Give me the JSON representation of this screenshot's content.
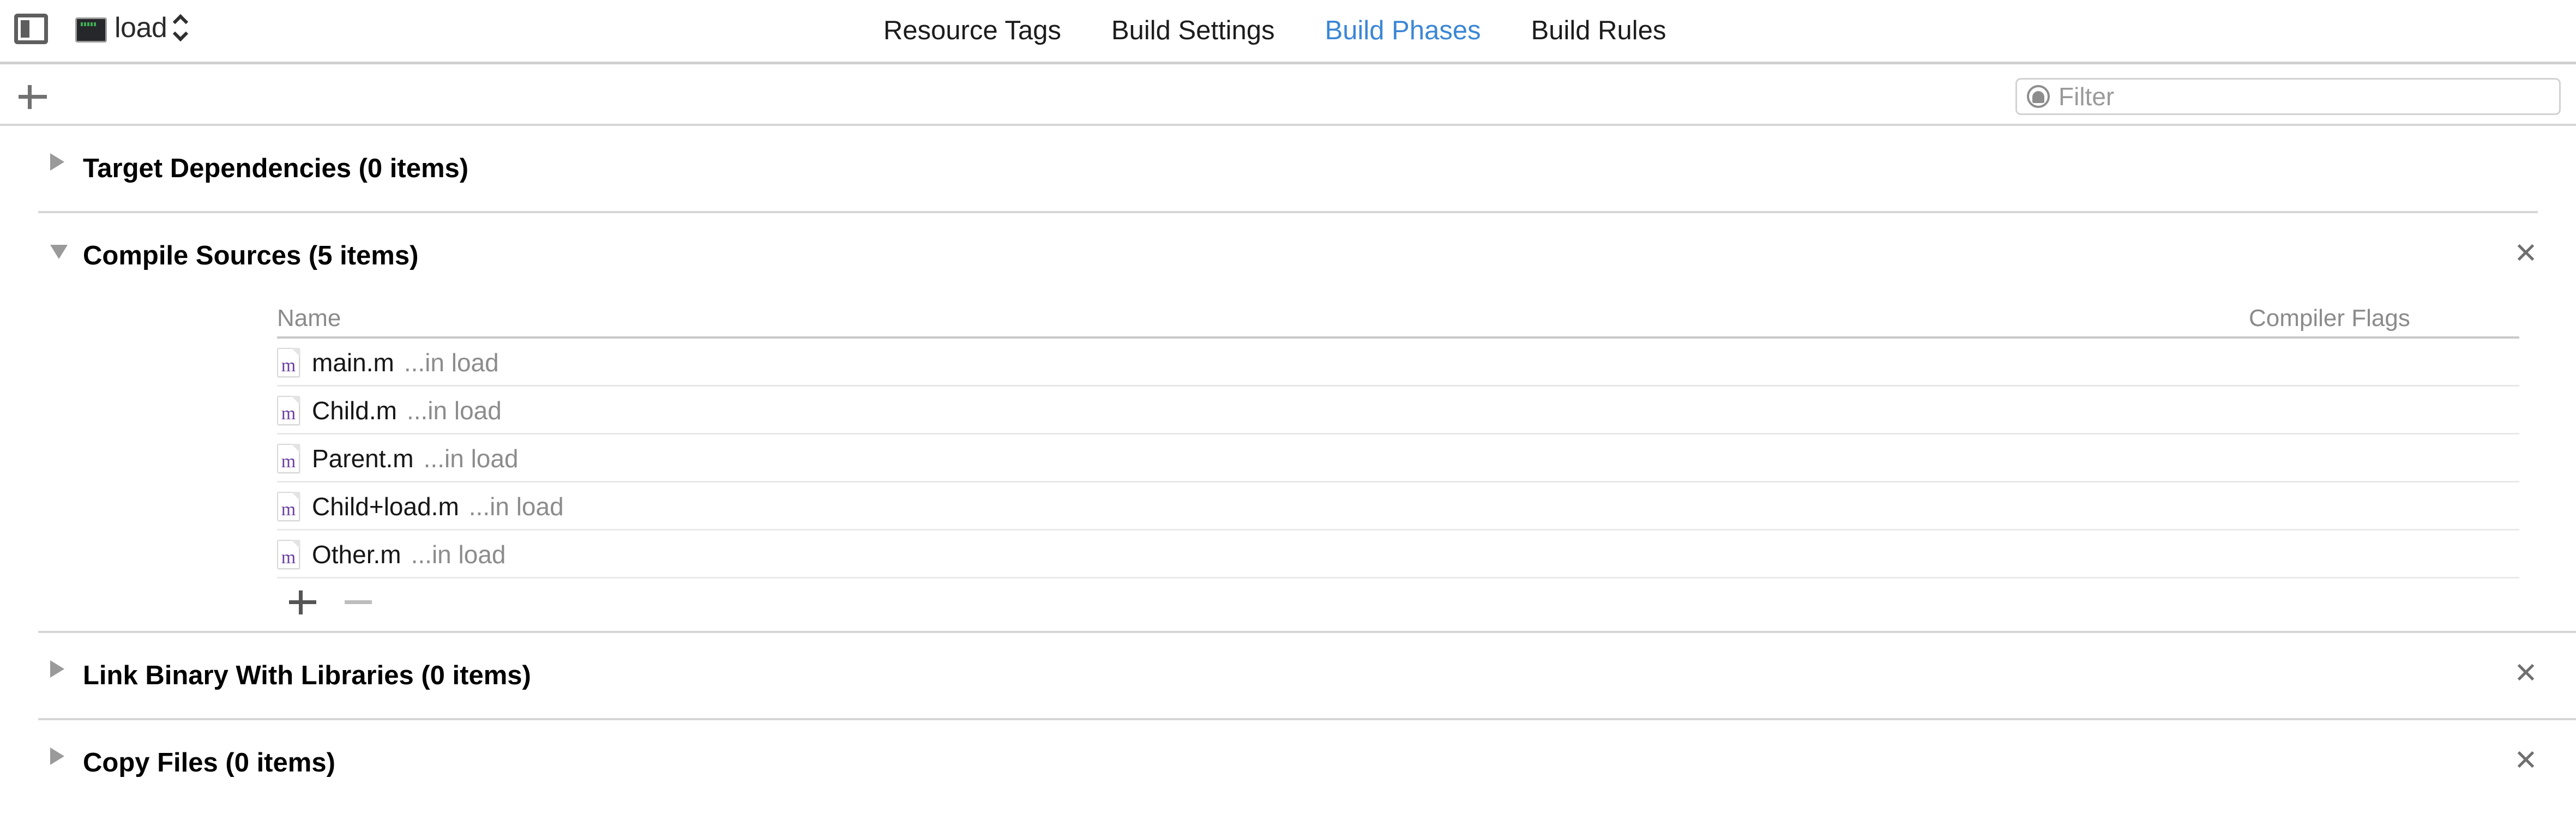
{
  "titlebar": {
    "sidebar_toggle_icon": "sidebar-toggle-icon",
    "target_icon": "command-line-tool-icon",
    "scheme_name": "load",
    "stepper_icon": "up-down-chevron-icon",
    "tabs": [
      {
        "label": "Resource Tags",
        "active": false
      },
      {
        "label": "Build Settings",
        "active": false
      },
      {
        "label": "Build Phases",
        "active": true
      },
      {
        "label": "Build Rules",
        "active": false
      }
    ],
    "active_tab_color": "#3b87d6"
  },
  "subbar": {
    "add_phase_icon": "plus-icon",
    "filter": {
      "icon": "filter-circle-icon",
      "placeholder": "Filter",
      "value": ""
    }
  },
  "phases": [
    {
      "title": "Target Dependencies (0 items)",
      "expanded": false,
      "disclosure_icon": "chevron-right-icon",
      "has_close": false,
      "close_icon": "close-icon"
    },
    {
      "title": "Compile Sources (5 items)",
      "expanded": true,
      "disclosure_icon": "chevron-down-icon",
      "has_close": true,
      "close_icon": "close-icon",
      "table": {
        "columns": [
          "Name",
          "Compiler Flags"
        ],
        "rows": [
          {
            "icon": "objc-file-icon",
            "icon_glyph": "m",
            "name": "main.m",
            "location": "...in load",
            "flags": ""
          },
          {
            "icon": "objc-file-icon",
            "icon_glyph": "m",
            "name": "Child.m",
            "location": "...in load",
            "flags": ""
          },
          {
            "icon": "objc-file-icon",
            "icon_glyph": "m",
            "name": "Parent.m",
            "location": "...in load",
            "flags": ""
          },
          {
            "icon": "objc-file-icon",
            "icon_glyph": "m",
            "name": "Child+load.m",
            "location": "...in load",
            "flags": ""
          },
          {
            "icon": "objc-file-icon",
            "icon_glyph": "m",
            "name": "Other.m",
            "location": "...in load",
            "flags": ""
          }
        ],
        "add_icon": "plus-icon",
        "remove_icon": "minus-icon"
      }
    },
    {
      "title": "Link Binary With Libraries (0 items)",
      "expanded": false,
      "disclosure_icon": "chevron-right-icon",
      "has_close": true,
      "close_icon": "close-icon"
    },
    {
      "title": "Copy Files (0 items)",
      "expanded": false,
      "disclosure_icon": "chevron-right-icon",
      "has_close": true,
      "close_icon": "close-icon"
    }
  ],
  "symbols": {
    "close": "✕"
  }
}
